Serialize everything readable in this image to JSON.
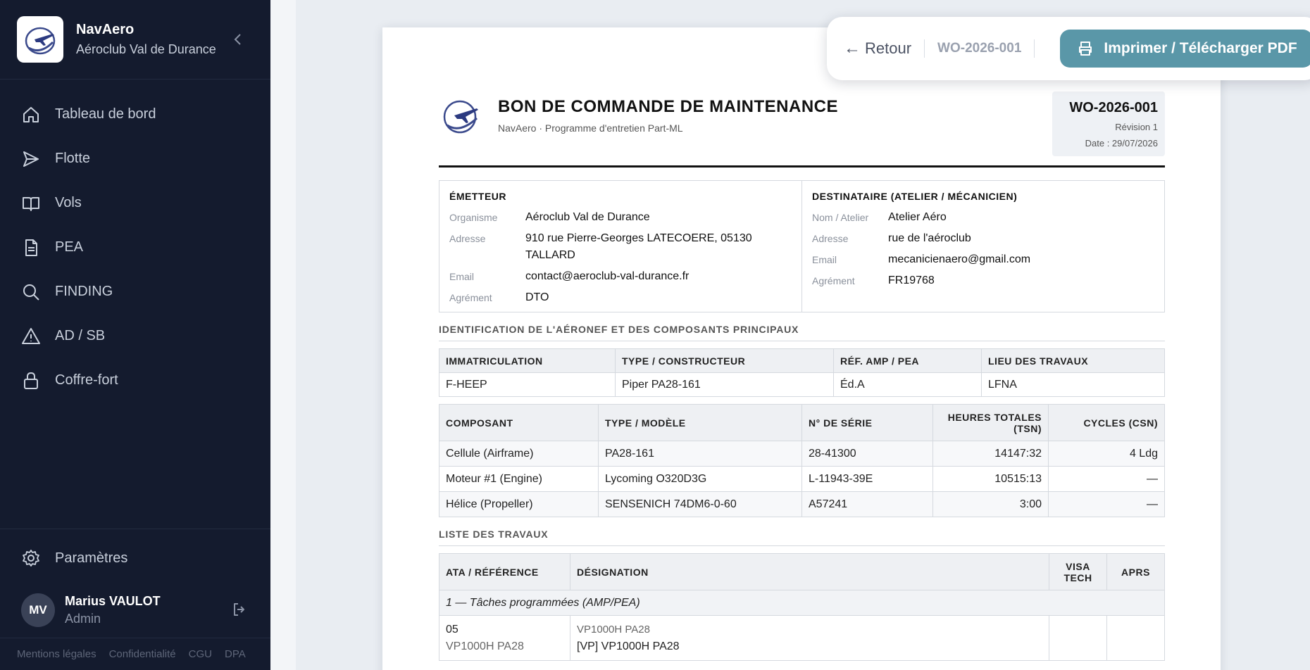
{
  "brand": {
    "name": "NavAero",
    "subtitle": "Aéroclub Val de Durance"
  },
  "nav": [
    {
      "label": "Tableau de bord",
      "icon": "home-icon"
    },
    {
      "label": "Flotte",
      "icon": "send-icon"
    },
    {
      "label": "Vols",
      "icon": "book-icon"
    },
    {
      "label": "PEA",
      "icon": "document-icon"
    },
    {
      "label": "FINDING",
      "icon": "search-icon"
    },
    {
      "label": "AD / SB",
      "icon": "warning-icon"
    },
    {
      "label": "Coffre-fort",
      "icon": "lock-icon"
    }
  ],
  "settings_label": "Paramètres",
  "user": {
    "initials": "MV",
    "name": "Marius VAULOT",
    "role": "Admin"
  },
  "legal": [
    "Mentions légales",
    "Confidentialité",
    "CGU",
    "DPA"
  ],
  "toolbar": {
    "back": "Retour",
    "ref": "WO-2026-001",
    "print": "Imprimer / Télécharger PDF"
  },
  "doc": {
    "title": "BON DE COMMANDE DE MAINTENANCE",
    "subtitle": "NavAero · Programme d'entretien Part-ML",
    "wo": "WO-2026-001",
    "revision": "Révision 1",
    "date": "Date : 29/07/2026",
    "emitter": {
      "title": "ÉMETTEUR",
      "rows": [
        {
          "k": "Organisme",
          "v": "Aéroclub Val de Durance"
        },
        {
          "k": "Adresse",
          "v": "910 rue Pierre-Georges LATECOERE, 05130 TALLARD"
        },
        {
          "k": "Email",
          "v": "contact@aeroclub-val-durance.fr"
        },
        {
          "k": "Agrément",
          "v": "DTO"
        }
      ]
    },
    "recipient": {
      "title": "DESTINATAIRE (ATELIER / MÉCANICIEN)",
      "rows": [
        {
          "k": "Nom / Atelier",
          "v": "Atelier Aéro"
        },
        {
          "k": "Adresse",
          "v": "rue de l'aéroclub"
        },
        {
          "k": "Email",
          "v": "mecanicienaero@gmail.com"
        },
        {
          "k": "Agrément",
          "v": "FR19768"
        }
      ]
    },
    "ident_title": "IDENTIFICATION DE L'AÉRONEF ET DES COMPOSANTS PRINCIPAUX",
    "aircraft": {
      "headers": [
        "IMMATRICULATION",
        "TYPE / CONSTRUCTEUR",
        "RÉF. AMP / PEA",
        "LIEU DES TRAVAUX"
      ],
      "row": [
        "F-HEEP",
        "Piper PA28-161",
        "Éd.A",
        "LFNA"
      ]
    },
    "components": {
      "headers": [
        "COMPOSANT",
        "TYPE / MODÈLE",
        "N° DE SÉRIE",
        "HEURES TOTALES (TSN)",
        "CYCLES (CSN)"
      ],
      "rows": [
        [
          "Cellule (Airframe)",
          "PA28-161",
          "28-41300",
          "14147:32",
          "4 Ldg"
        ],
        [
          "Moteur #1 (Engine)",
          "Lycoming O320D3G",
          "L-11943-39E",
          "10515:13",
          "—"
        ],
        [
          "Hélice (Propeller)",
          "SENSENICH 74DM6-0-60",
          "A57241",
          "3:00",
          "—"
        ]
      ]
    },
    "works_title": "LISTE DES TRAVAUX",
    "works": {
      "headers": [
        "ATA / RÉFÉRENCE",
        "DÉSIGNATION",
        "VISA TECH",
        "APRS"
      ],
      "group": "1 — Tâches programmées (AMP/PEA)",
      "task": {
        "ata": "05",
        "ref": "VP1000H PA28",
        "des_small": "VP1000H PA28",
        "des": "[VP] VP1000H PA28"
      }
    }
  }
}
